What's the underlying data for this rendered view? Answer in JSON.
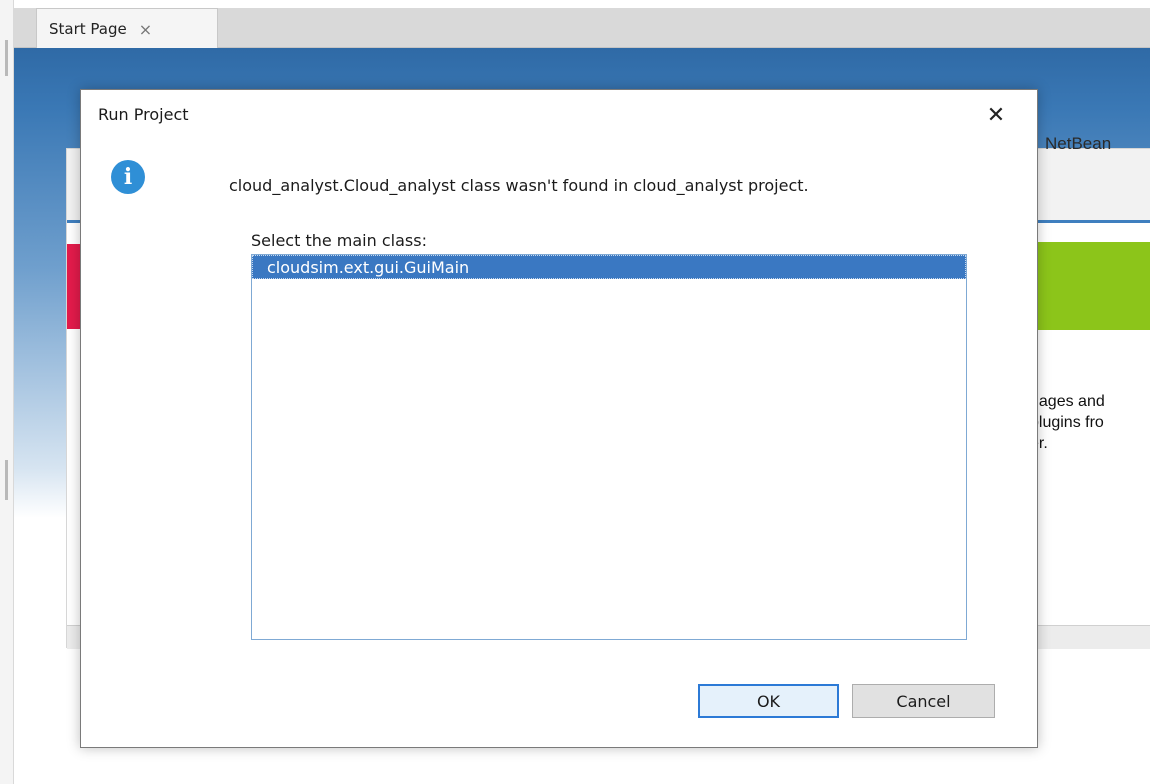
{
  "editor": {
    "tab": {
      "label": "Start Page",
      "close_glyph": "×"
    },
    "background": {
      "header_text": "NetBean",
      "lines": [
        "uages and",
        "plugins fro",
        "er."
      ]
    }
  },
  "dialog": {
    "title": "Run Project",
    "close_glyph": "✕",
    "icon": "info-icon",
    "message": "cloud_analyst.Cloud_analyst class wasn't found in cloud_analyst project.",
    "list_label": "Select the main class:",
    "classes": [
      "cloudsim.ext.gui.GuiMain"
    ],
    "selected_index": 0,
    "buttons": {
      "ok": "OK",
      "cancel": "Cancel"
    }
  },
  "colors": {
    "accent": "#3a78c2",
    "tab_bar": "#d9d9d9",
    "start_page_blue": "#2f6aa6",
    "red_banner": "#e31b4b",
    "green_banner": "#8cc51a",
    "info_blue": "#2f8fd6"
  }
}
